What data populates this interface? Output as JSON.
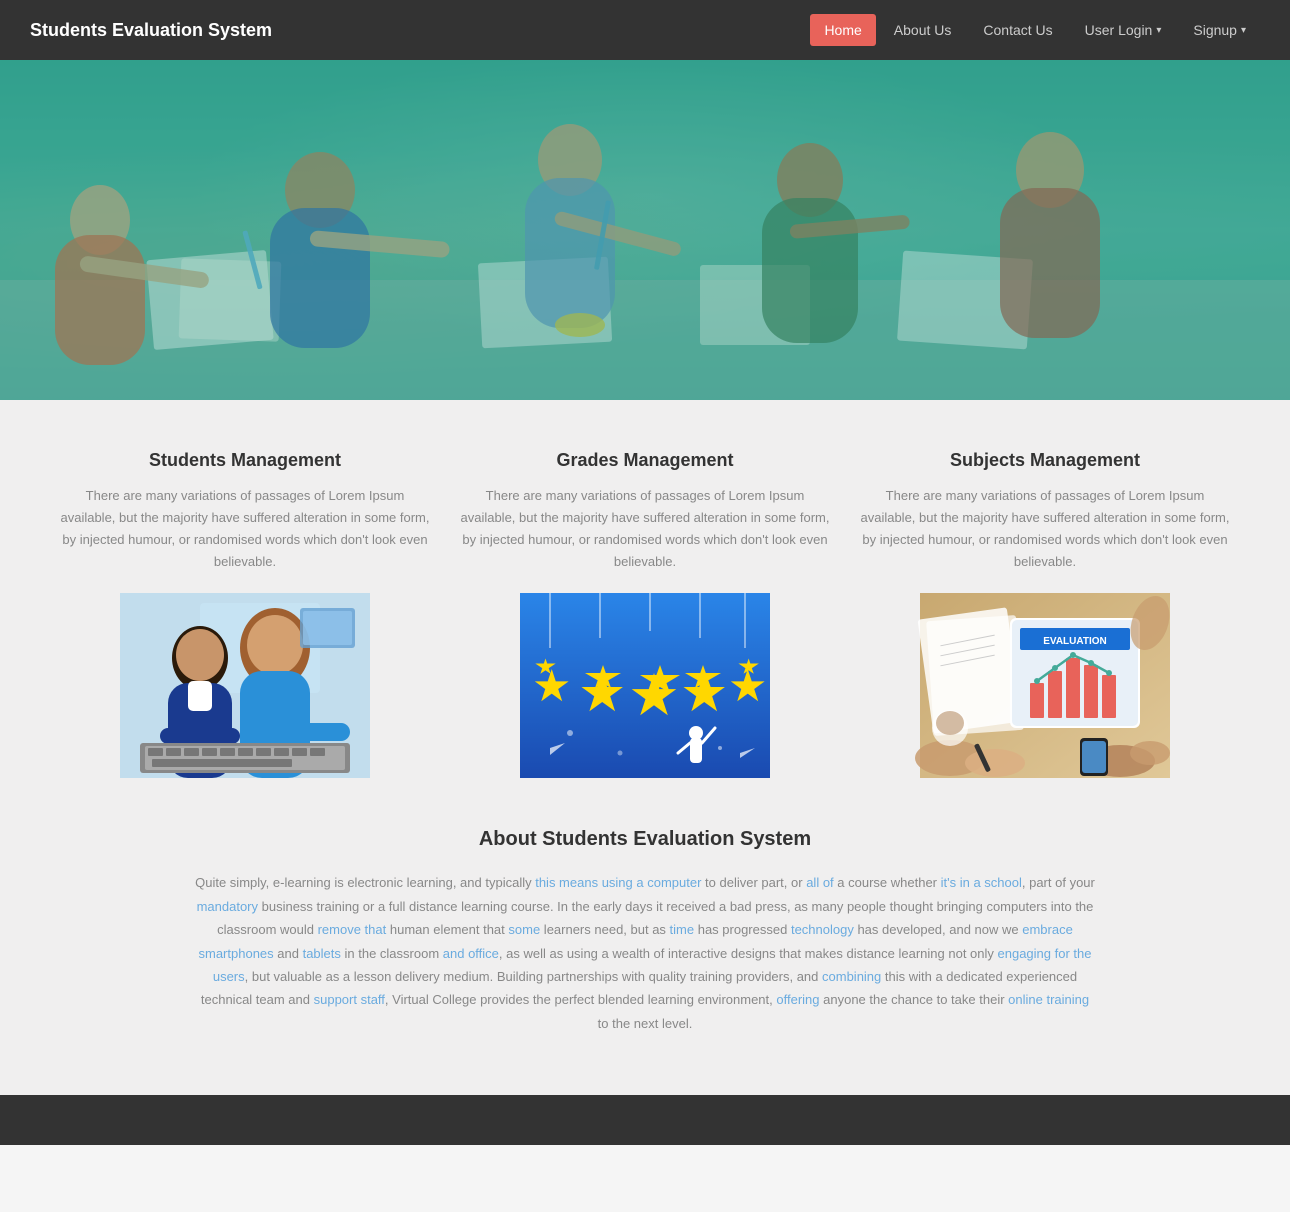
{
  "navbar": {
    "brand": "Students Evaluation System",
    "links": [
      {
        "id": "home",
        "label": "Home",
        "active": true
      },
      {
        "id": "about",
        "label": "About Us",
        "active": false
      },
      {
        "id": "contact",
        "label": "Contact Us",
        "active": false
      },
      {
        "id": "userlogin",
        "label": "User Login",
        "active": false,
        "dropdown": true
      },
      {
        "id": "signup",
        "label": "Signup",
        "active": false,
        "dropdown": true
      }
    ]
  },
  "hero": {
    "alt": "Students studying together"
  },
  "columns": [
    {
      "id": "students-mgmt",
      "title": "Students Management",
      "text": "There are many variations of passages of Lorem Ipsum available, but the majority have suffered alteration in some form, by injected humour, or randomised words which don't look even believable.",
      "img_alt": "Students at computer"
    },
    {
      "id": "grades-mgmt",
      "title": "Grades Management",
      "text": "There are many variations of passages of Lorem Ipsum available, but the majority have suffered alteration in some form, by injected humour, or randomised words which don't look even believable.",
      "img_alt": "Five stars rating"
    },
    {
      "id": "subjects-mgmt",
      "title": "Subjects Management",
      "text": "There are many variations of passages of Lorem Ipsum available, but the majority have suffered alteration in some form, by injected humour, or randomised words which don't look even believable.",
      "img_alt": "Evaluation tablet"
    }
  ],
  "about": {
    "title": "About Students Evaluation System",
    "text": "Quite simply, e-learning is electronic learning, and typically this means using a computer to deliver part, or all of a course whether it's in a school, part of your mandatory business training or a full distance learning course. In the early days it received a bad press, as many people thought bringing computers into the classroom would remove that human element that some learners need, but as time has progressed technology has developed, and now we embrace smartphones and tablets in the classroom and office, as well as using a wealth of interactive designs that makes distance learning not only engaging for the users, but valuable as a lesson delivery medium. Building partnerships with quality training providers, and combining this with a dedicated experienced technical team and support staff, Virtual College provides the perfect blended learning environment, offering anyone the chance to take their online training to the next level."
  },
  "footer": {
    "text": ""
  },
  "colors": {
    "accent": "#e8635a",
    "nav_bg": "#333333",
    "teal_overlay": "rgba(50,160,140,0.5)",
    "link_color": "#6aabdf"
  }
}
